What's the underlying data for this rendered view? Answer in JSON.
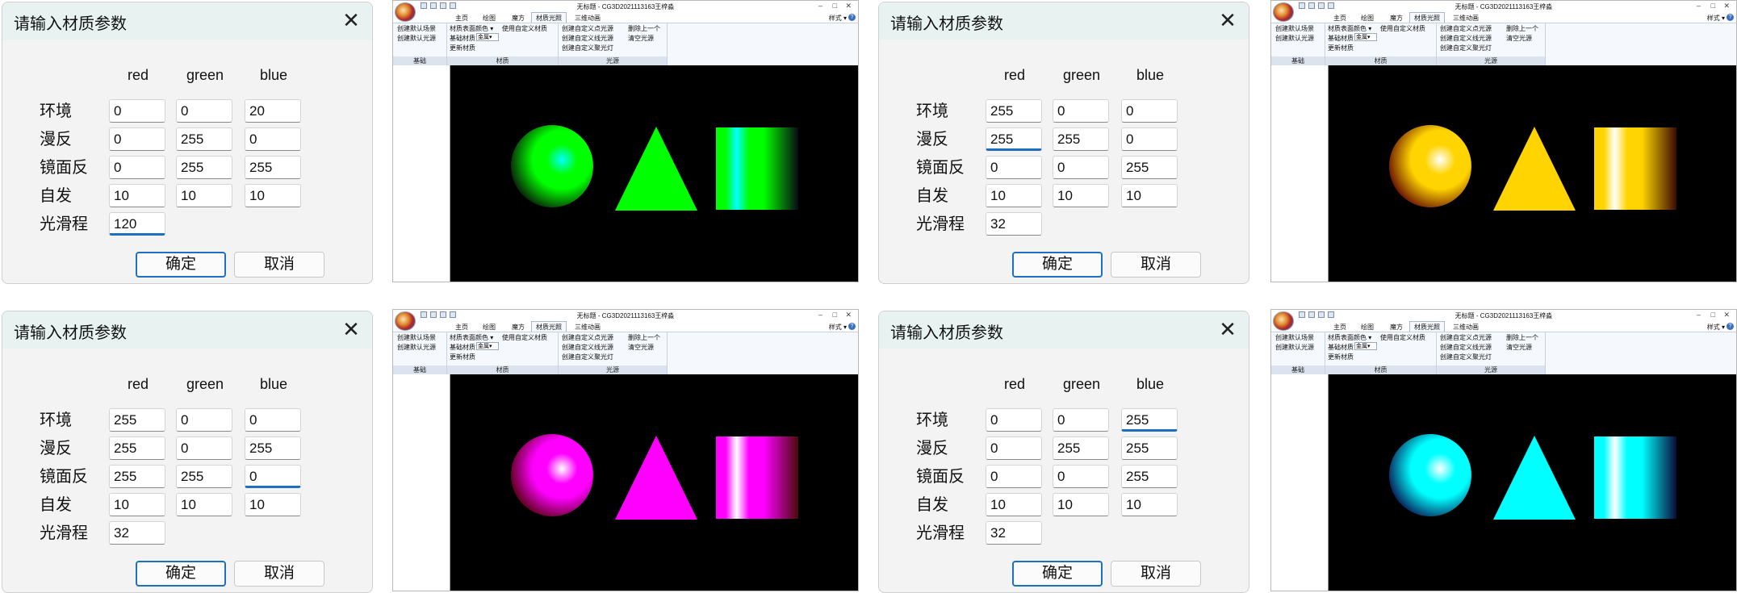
{
  "dialogs": [
    {
      "title": "请输入材质参数",
      "headers": [
        "red",
        "green",
        "blue"
      ],
      "labels": [
        "环境",
        "漫反",
        "镜面反",
        "自发",
        "光滑程"
      ],
      "values": [
        [
          "0",
          "0",
          "20"
        ],
        [
          "0",
          "255",
          "0"
        ],
        [
          "0",
          "255",
          "255"
        ],
        [
          "10",
          "10",
          "10"
        ],
        [
          "120"
        ]
      ],
      "ok": "确定",
      "cancel": "取消"
    },
    {
      "title": "请输入材质参数",
      "headers": [
        "red",
        "green",
        "blue"
      ],
      "labels": [
        "环境",
        "漫反",
        "镜面反",
        "自发",
        "光滑程"
      ],
      "values": [
        [
          "255",
          "0",
          "0"
        ],
        [
          "255",
          "255",
          "0"
        ],
        [
          "0",
          "0",
          "255"
        ],
        [
          "10",
          "10",
          "10"
        ],
        [
          "32"
        ]
      ],
      "ok": "确定",
      "cancel": "取消"
    },
    {
      "title": "请输入材质参数",
      "headers": [
        "red",
        "green",
        "blue"
      ],
      "labels": [
        "环境",
        "漫反",
        "镜面反",
        "自发",
        "光滑程"
      ],
      "values": [
        [
          "255",
          "0",
          "0"
        ],
        [
          "255",
          "0",
          "255"
        ],
        [
          "255",
          "255",
          "0"
        ],
        [
          "10",
          "10",
          "10"
        ],
        [
          "32"
        ]
      ],
      "ok": "确定",
      "cancel": "取消"
    },
    {
      "title": "请输入材质参数",
      "headers": [
        "red",
        "green",
        "blue"
      ],
      "labels": [
        "环境",
        "漫反",
        "镜面反",
        "自发",
        "光滑程"
      ],
      "values": [
        [
          "0",
          "0",
          "255"
        ],
        [
          "0",
          "255",
          "255"
        ],
        [
          "0",
          "0",
          "255"
        ],
        [
          "10",
          "10",
          "10"
        ],
        [
          "32"
        ]
      ],
      "ok": "确定",
      "cancel": "取消"
    }
  ],
  "app": {
    "title": "无标题 - CG3D2021113163王梓淼",
    "tabs": [
      "主页",
      "绘图",
      "魔方",
      "材质光照",
      "三维动画"
    ],
    "style_label": "样式",
    "ribbon": {
      "basic_group": "基础",
      "basic_items": [
        "创建默认场景",
        "创建默认光源"
      ],
      "material_group": "材质",
      "material_items": [
        "材质表面颜色",
        "使用自定义材质",
        "基础材质",
        "更新材质"
      ],
      "material_select": "金属",
      "light_group": "光源",
      "light_items": [
        "创建自定义点光源",
        "创建自定义线光源",
        "创建自定义聚光灯",
        "删除上一个",
        "清空光源"
      ]
    }
  },
  "scenes": [
    {
      "name": "green",
      "color": "#00ff00",
      "spec": "#00ffff",
      "dark": "#0a0a0a",
      "emissive": "#0a0a14"
    },
    {
      "name": "yellow",
      "color": "#ffd400",
      "spec": "#ffffff",
      "dark": "#5a0000",
      "emissive": "#3a0a06"
    },
    {
      "name": "magenta",
      "color": "#ff00ff",
      "spec": "#ffffff",
      "dark": "#4a0000",
      "emissive": "#4a0a0a"
    },
    {
      "name": "cyan",
      "color": "#00ffff",
      "spec": "#ffffff",
      "dark": "#0a0a4a",
      "emissive": "#0a0a3a"
    }
  ]
}
